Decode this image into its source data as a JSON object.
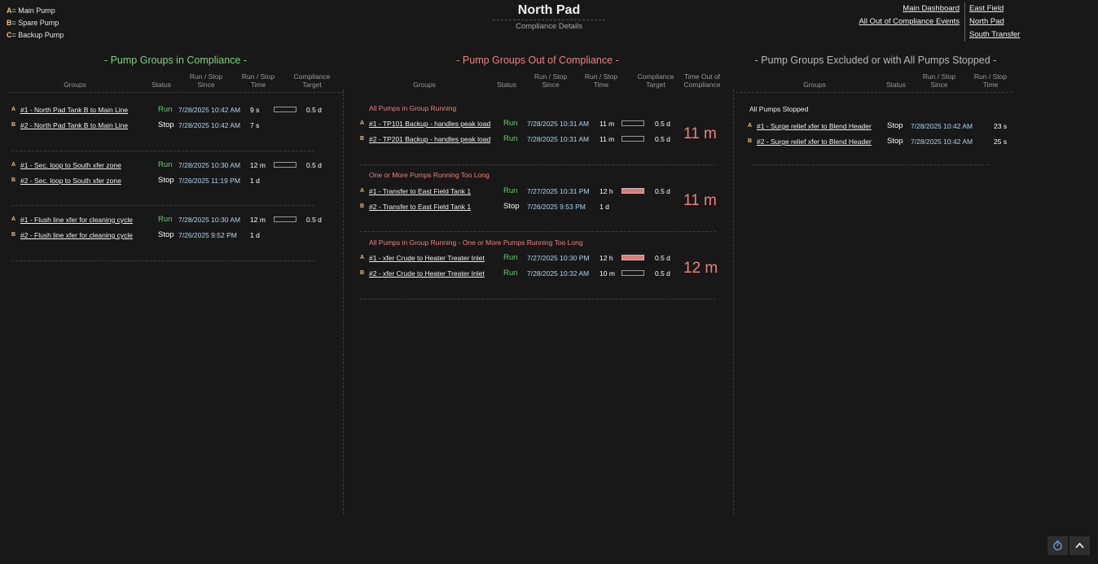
{
  "legend": [
    {
      "key": "A",
      "text": "= Main Pump"
    },
    {
      "key": "B",
      "text": "= Spare Pump"
    },
    {
      "key": "C",
      "text": "= Backup Pump"
    }
  ],
  "header": {
    "title": "North Pad",
    "subtitle": "Compliance Details"
  },
  "nav": {
    "left": [
      "Main Dashboard",
      "All Out of Compliance Events"
    ],
    "right": [
      "East Field",
      "North Pad",
      "South Transfer"
    ]
  },
  "panels": {
    "compliance": {
      "title": "- Pump Groups in Compliance -",
      "columns": [
        "Groups",
        "Status",
        "Run / Stop Since",
        "Run / Stop Time",
        "Compliance Target"
      ],
      "groups": [
        {
          "pumps": [
            {
              "letter": "A",
              "name": "#1 - North Pad Tank B to Main Line",
              "status": "Run",
              "since": "7/28/2025 10:42 AM",
              "time": "9 s",
              "target": "0.5 d",
              "fill": false
            },
            {
              "letter": "B",
              "name": "#2 - North Pad Tank B to Main Line",
              "status": "Stop",
              "since": "7/28/2025 10:42 AM",
              "time": "7 s"
            }
          ]
        },
        {
          "pumps": [
            {
              "letter": "A",
              "name": "#1 - Sec. loop to South xfer zone",
              "status": "Run",
              "since": "7/28/2025 10:30 AM",
              "time": "12 m",
              "target": "0.5 d",
              "fill": false
            },
            {
              "letter": "B",
              "name": "#2 - Sec. loop to South xfer zone",
              "status": "Stop",
              "since": "7/26/2025 11:19 PM",
              "time": "1 d"
            }
          ]
        },
        {
          "pumps": [
            {
              "letter": "A",
              "name": "#1 - Flush line xfer for cleaning cycle",
              "status": "Run",
              "since": "7/28/2025 10:30 AM",
              "time": "12 m",
              "target": "0.5 d",
              "fill": false
            },
            {
              "letter": "B",
              "name": "#2 - Flush line xfer for cleaning cycle",
              "status": "Stop",
              "since": "7/26/2025 9:52 PM",
              "time": "1 d"
            }
          ]
        }
      ]
    },
    "out": {
      "title": "- Pump Groups Out of Compliance -",
      "columns": [
        "Groups",
        "Status",
        "Run / Stop Since",
        "Run / Stop Time",
        "Compliance Target",
        "Time Out of Compliance"
      ],
      "groups": [
        {
          "heading": "All Pumps in Group Running",
          "time_out": "11 m",
          "pumps": [
            {
              "letter": "A",
              "name": "#1 - TP101 Backup - handles peak load",
              "status": "Run",
              "since": "7/28/2025 10:31 AM",
              "time": "11 m",
              "target": "0.5 d",
              "fill": false
            },
            {
              "letter": "B",
              "name": "#2 - TP201 Backup - handles peak load",
              "status": "Run",
              "since": "7/28/2025 10:31 AM",
              "time": "11 m",
              "target": "0.5 d",
              "fill": false
            }
          ]
        },
        {
          "heading": "One or More Pumps Running Too Long",
          "time_out": "11 m",
          "pumps": [
            {
              "letter": "A",
              "name": "#1 - Transfer to East Field Tank 1",
              "status": "Run",
              "since": "7/27/2025 10:31 PM",
              "time": "12 h",
              "target": "0.5 d",
              "fill": true
            },
            {
              "letter": "B",
              "name": "#2 - Transfer to East Field Tank 1",
              "status": "Stop",
              "since": "7/26/2025 9:53 PM",
              "time": "1 d"
            }
          ]
        },
        {
          "heading": "All Pumps in Group Running - One or More Pumps Running Too Long",
          "time_out": "12 m",
          "pumps": [
            {
              "letter": "A",
              "name": "#1 - xfer Crude to Heater Treater Inlet",
              "status": "Run",
              "since": "7/27/2025 10:30 PM",
              "time": "12 h",
              "target": "0.5 d",
              "fill": true
            },
            {
              "letter": "B",
              "name": "#2 - xfer Crude to Heater Treater Inlet",
              "status": "Run",
              "since": "7/28/2025 10:32 AM",
              "time": "10 m",
              "target": "0.5 d",
              "fill": false
            }
          ]
        }
      ]
    },
    "excluded": {
      "title": "- Pump Groups Excluded or with All Pumps Stopped -",
      "columns": [
        "Groups",
        "Status",
        "Run / Stop Since",
        "Run / Stop Time"
      ],
      "groups": [
        {
          "heading": "All Pumps Stopped",
          "pumps": [
            {
              "letter": "A",
              "name": "#1 - Surge relief xfer to Blend Header",
              "status": "Stop",
              "since": "7/28/2025 10:42 AM",
              "time": "23 s"
            },
            {
              "letter": "B",
              "name": "#2 - Surge relief xfer to Blend Header",
              "status": "Stop",
              "since": "7/28/2025 10:42 AM",
              "time": "25 s"
            }
          ]
        }
      ]
    }
  },
  "controls": {
    "timer": "timer-icon",
    "up": "chevron-up-icon"
  }
}
